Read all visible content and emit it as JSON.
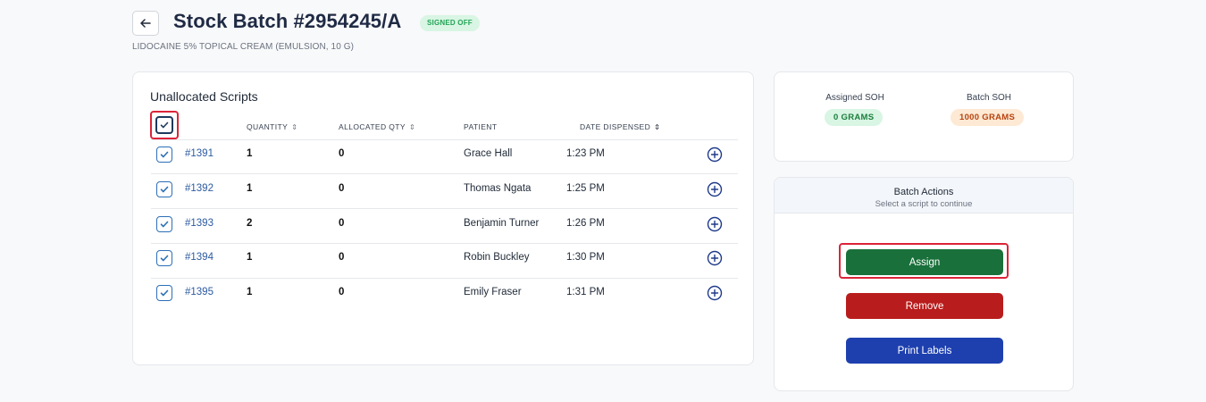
{
  "header": {
    "title": "Stock Batch #2954245/A",
    "status_badge": "SIGNED OFF",
    "subtitle": "LIDOCAINE 5% TOPICAL CREAM (EMULSION, 10 G)"
  },
  "scripts": {
    "heading": "Unallocated Scripts",
    "columns": {
      "quantity": "QUANTITY",
      "allocated": "ALLOCATED QTY",
      "patient": "PATIENT",
      "date": "DATE DISPENSED"
    },
    "rows": [
      {
        "id": "#1391",
        "quantity": "1",
        "allocated": "0",
        "patient": "Grace Hall",
        "date": "1:23 PM",
        "checked": true
      },
      {
        "id": "#1392",
        "quantity": "1",
        "allocated": "0",
        "patient": "Thomas Ngata",
        "date": "1:25 PM",
        "checked": true
      },
      {
        "id": "#1393",
        "quantity": "2",
        "allocated": "0",
        "patient": "Benjamin Turner",
        "date": "1:26 PM",
        "checked": true
      },
      {
        "id": "#1394",
        "quantity": "1",
        "allocated": "0",
        "patient": "Robin Buckley",
        "date": "1:30 PM",
        "checked": true
      },
      {
        "id": "#1395",
        "quantity": "1",
        "allocated": "0",
        "patient": "Emily Fraser",
        "date": "1:31 PM",
        "checked": true
      }
    ]
  },
  "soh": {
    "assigned_label": "Assigned SOH",
    "assigned_value": "0 GRAMS",
    "batch_label": "Batch SOH",
    "batch_value": "1000 GRAMS"
  },
  "actions": {
    "title": "Batch Actions",
    "subtitle": "Select a script to continue",
    "assign_label": "Assign",
    "remove_label": "Remove",
    "print_label": "Print Labels"
  },
  "icons": {
    "back": "arrow-left-icon",
    "check": "check-icon",
    "sort": "sort-icon",
    "add": "plus-circle-icon"
  },
  "colors": {
    "accent_blue": "#2c5aa0",
    "assign_green": "#19703a",
    "remove_red": "#b91c1c",
    "print_blue": "#1e40af",
    "highlight_red": "#dc2438"
  }
}
